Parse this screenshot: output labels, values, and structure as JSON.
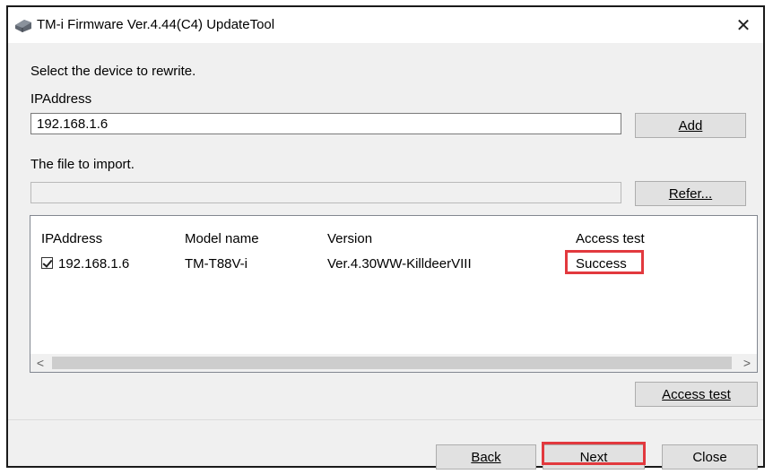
{
  "window": {
    "title": "TM-i Firmware Ver.4.44(C4) UpdateTool",
    "close_glyph": "✕"
  },
  "form": {
    "instruction": "Select the device to rewrite.",
    "ip_label": "IPAddress",
    "ip_value": "192.168.1.6",
    "add_button": "Add",
    "file_label": "The file to import.",
    "file_value": "",
    "refer_button": "Refer..."
  },
  "device_list": {
    "columns": [
      "IPAddress",
      "Model name",
      "Version",
      "Access test"
    ],
    "rows": [
      {
        "checked": true,
        "ip": "192.168.1.6",
        "model": "TM-T88V-i",
        "version": "Ver.4.30WW-KilldeerVIII",
        "access_test": "Success"
      }
    ],
    "scroll_left": "<",
    "scroll_right": ">"
  },
  "buttons": {
    "access_test": "Access test",
    "back": "Back",
    "next": "Next",
    "close": "Close"
  },
  "colors": {
    "highlight": "#e2393e",
    "window_bg": "#f0f0f0"
  },
  "icons": {
    "app": "printer-app-icon",
    "close": "close-icon"
  }
}
